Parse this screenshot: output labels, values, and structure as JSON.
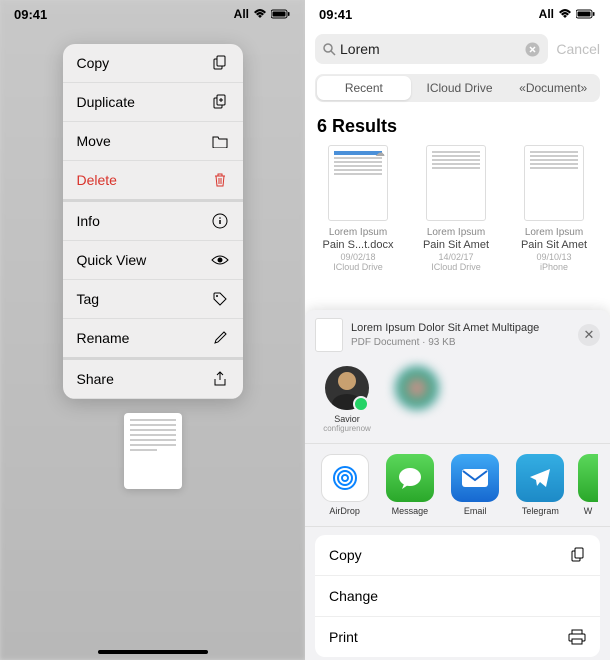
{
  "status": {
    "time": "09:41",
    "carrier": "All"
  },
  "menu": {
    "copy": "Copy",
    "duplicate": "Duplicate",
    "move": "Move",
    "delete": "Delete",
    "info": "Info",
    "quicklook": "Quick View",
    "tags": "Tag",
    "rename": "Rename",
    "share": "Share"
  },
  "search": {
    "query": "Lorem",
    "cancel": "Cancel",
    "tabs": {
      "recent": "Recent",
      "icloud": "ICloud Drive",
      "docs": "«Document»"
    },
    "results_title": "6 Results",
    "results": [
      {
        "cat": "Lorem Ipsum",
        "name": "Pain S...t.docx",
        "date": "09/02/18",
        "loc": "ICloud Drive"
      },
      {
        "cat": "Lorem Ipsum",
        "name": "Pain Sit Amet",
        "date": "14/02/17",
        "loc": "ICloud Drive"
      },
      {
        "cat": "Lorem Ipsum",
        "name": "Pain Sit Amet",
        "date": "09/10/13",
        "loc": "iPhone"
      }
    ]
  },
  "sharesheet": {
    "title": "Lorem Ipsum Dolor Sit Amet Multipage",
    "subtitle": "PDF Document · 93 KB",
    "contacts": [
      {
        "name": "Savior",
        "sub": "configurenow"
      },
      {
        "name": "",
        "sub": ""
      }
    ],
    "apps": {
      "airdrop": "AirDrop",
      "messages": "Message",
      "mail": "Email",
      "telegram": "Telegram",
      "more": "W"
    },
    "actions": {
      "copy": "Copy",
      "change": "Change",
      "print": "Print"
    }
  }
}
